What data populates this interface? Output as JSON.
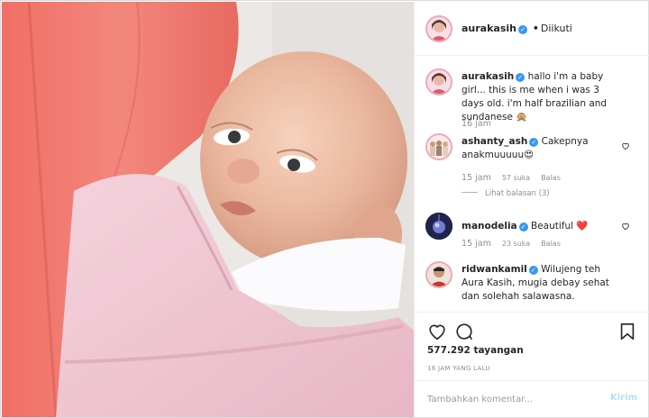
{
  "post": {
    "image_alt": "Newborn baby wrapped in a pink towel",
    "author": "aurakasih",
    "verified": true,
    "follow_status": "Diikuti",
    "separator": "•"
  },
  "comments": [
    {
      "user": "aurakasih",
      "text": "hallo i'm a baby girl... this is me when i was 3 days old. i'm half brazilian and sundanese 🙊",
      "time": "16 jam"
    },
    {
      "user": "ashanty_ash",
      "text": "Cakepnya anakmuuuuu😍",
      "time": "15 jam",
      "likes": "57 suka",
      "reply": "Balas",
      "view_replies": "Lihat balasan (3)"
    },
    {
      "user": "manodelia",
      "text": "Beautiful ❤️",
      "time": "15 jam",
      "likes": "23 suka",
      "reply": "Balas"
    },
    {
      "user": "ridwankamil",
      "text": "Wilujeng teh Aura Kasih, mugia debay sehat dan solehah salawasna."
    }
  ],
  "actions": {
    "like_icon": "heart-icon",
    "comment_icon": "comment-icon",
    "save_icon": "bookmark-icon",
    "views": "577.292 tayangan",
    "posted": "16 JAM YANG LALU"
  },
  "comment_box": {
    "placeholder": "Tambahkan komentar...",
    "send_label": "Kirim"
  },
  "colors": {
    "verified": "#3897f0",
    "heart_red": "#ed4956",
    "send_disabled": "#b2dffc",
    "meta_gray": "#8e8e8e"
  }
}
